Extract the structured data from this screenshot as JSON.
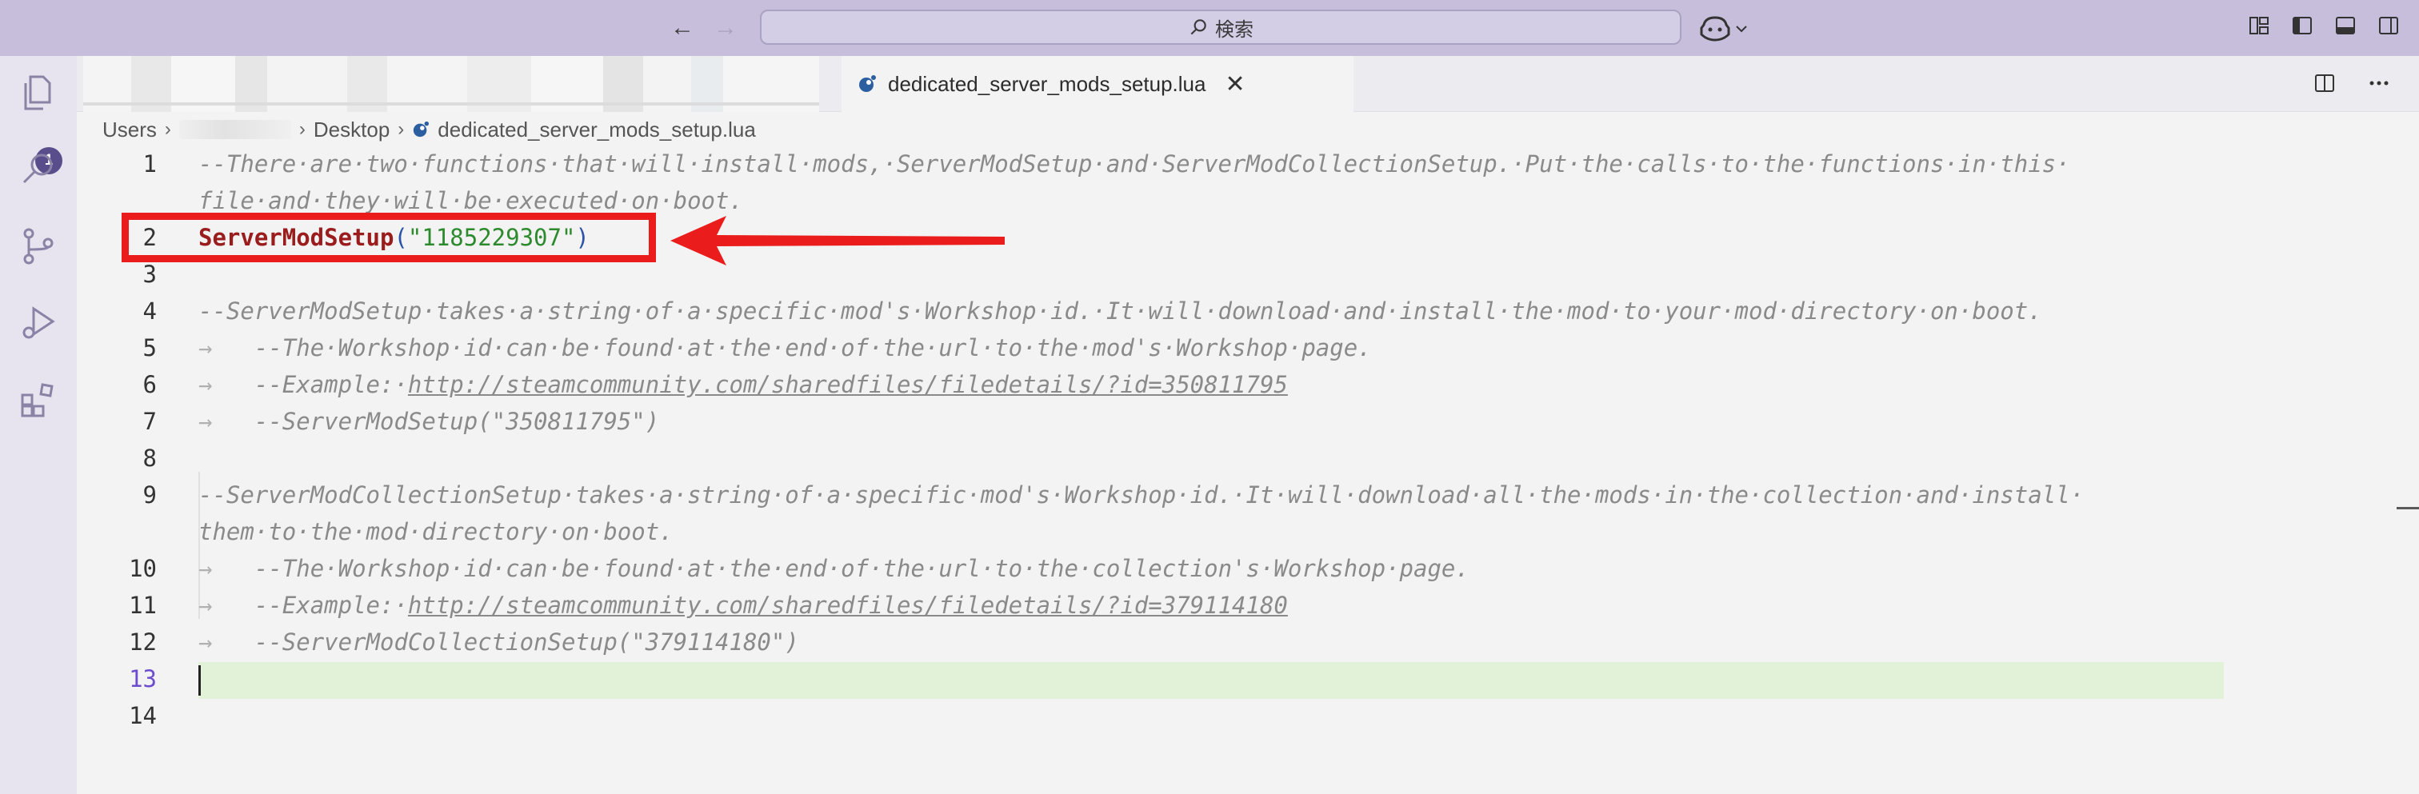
{
  "titlebar": {
    "back_icon": "arrow-left-icon",
    "forward_icon": "arrow-right-icon",
    "search_label": "検索",
    "copilot_icon": "copilot-icon"
  },
  "activity": {
    "explorer_badge": "1"
  },
  "tabs": {
    "active_label": "dedicated_server_mods_setup.lua",
    "close_glyph": "✕"
  },
  "breadcrumb": {
    "users": "Users",
    "desktop": "Desktop",
    "file": "dedicated_server_mods_setup.lua",
    "sep": "›"
  },
  "editor": {
    "line_numbers": [
      "1",
      "2",
      "3",
      "4",
      "5",
      "6",
      "7",
      "8",
      "9",
      "10",
      "11",
      "12",
      "13",
      "14"
    ],
    "line1a": "--There·are·two·functions·that·will·install·mods,·ServerModSetup·and·ServerModCollectionSetup.·Put·the·calls·to·the·functions·in·this·",
    "line1b": "file·and·they·will·be·executed·on·boot.",
    "line2_fn": "ServerModSetup",
    "line2_open": "(",
    "line2_str": "\"1185229307\"",
    "line2_close": ")",
    "line4": "--ServerModSetup·takes·a·string·of·a·specific·mod's·Workshop·id.·It·will·download·and·install·the·mod·to·your·mod·directory·on·boot.",
    "line5": "--The·Workshop·id·can·be·found·at·the·end·of·the·url·to·the·mod's·Workshop·page.",
    "line6_prefix": "--Example:·",
    "line6_url": "http://steamcommunity.com/sharedfiles/filedetails/?id=350811795",
    "line7": "--ServerModSetup(\"350811795\")",
    "line9a": "--ServerModCollectionSetup·takes·a·string·of·a·specific·mod's·Workshop·id.·It·will·download·all·the·mods·in·the·collection·and·install·",
    "line9b": "them·to·the·mod·directory·on·boot.",
    "line10": "--The·Workshop·id·can·be·found·at·the·end·of·the·url·to·the·collection's·Workshop·page.",
    "line11_prefix": "--Example:·",
    "line11_url": "http://steamcommunity.com/sharedfiles/filedetails/?id=379114180",
    "line12": "--ServerModCollectionSetup(\"379114180\")",
    "tab_glyph": "→"
  },
  "colors": {
    "annotation": "#ea1c1c",
    "titlebar": "#c7bedc",
    "function": "#9b1c1c",
    "string": "#2e8a2e"
  }
}
